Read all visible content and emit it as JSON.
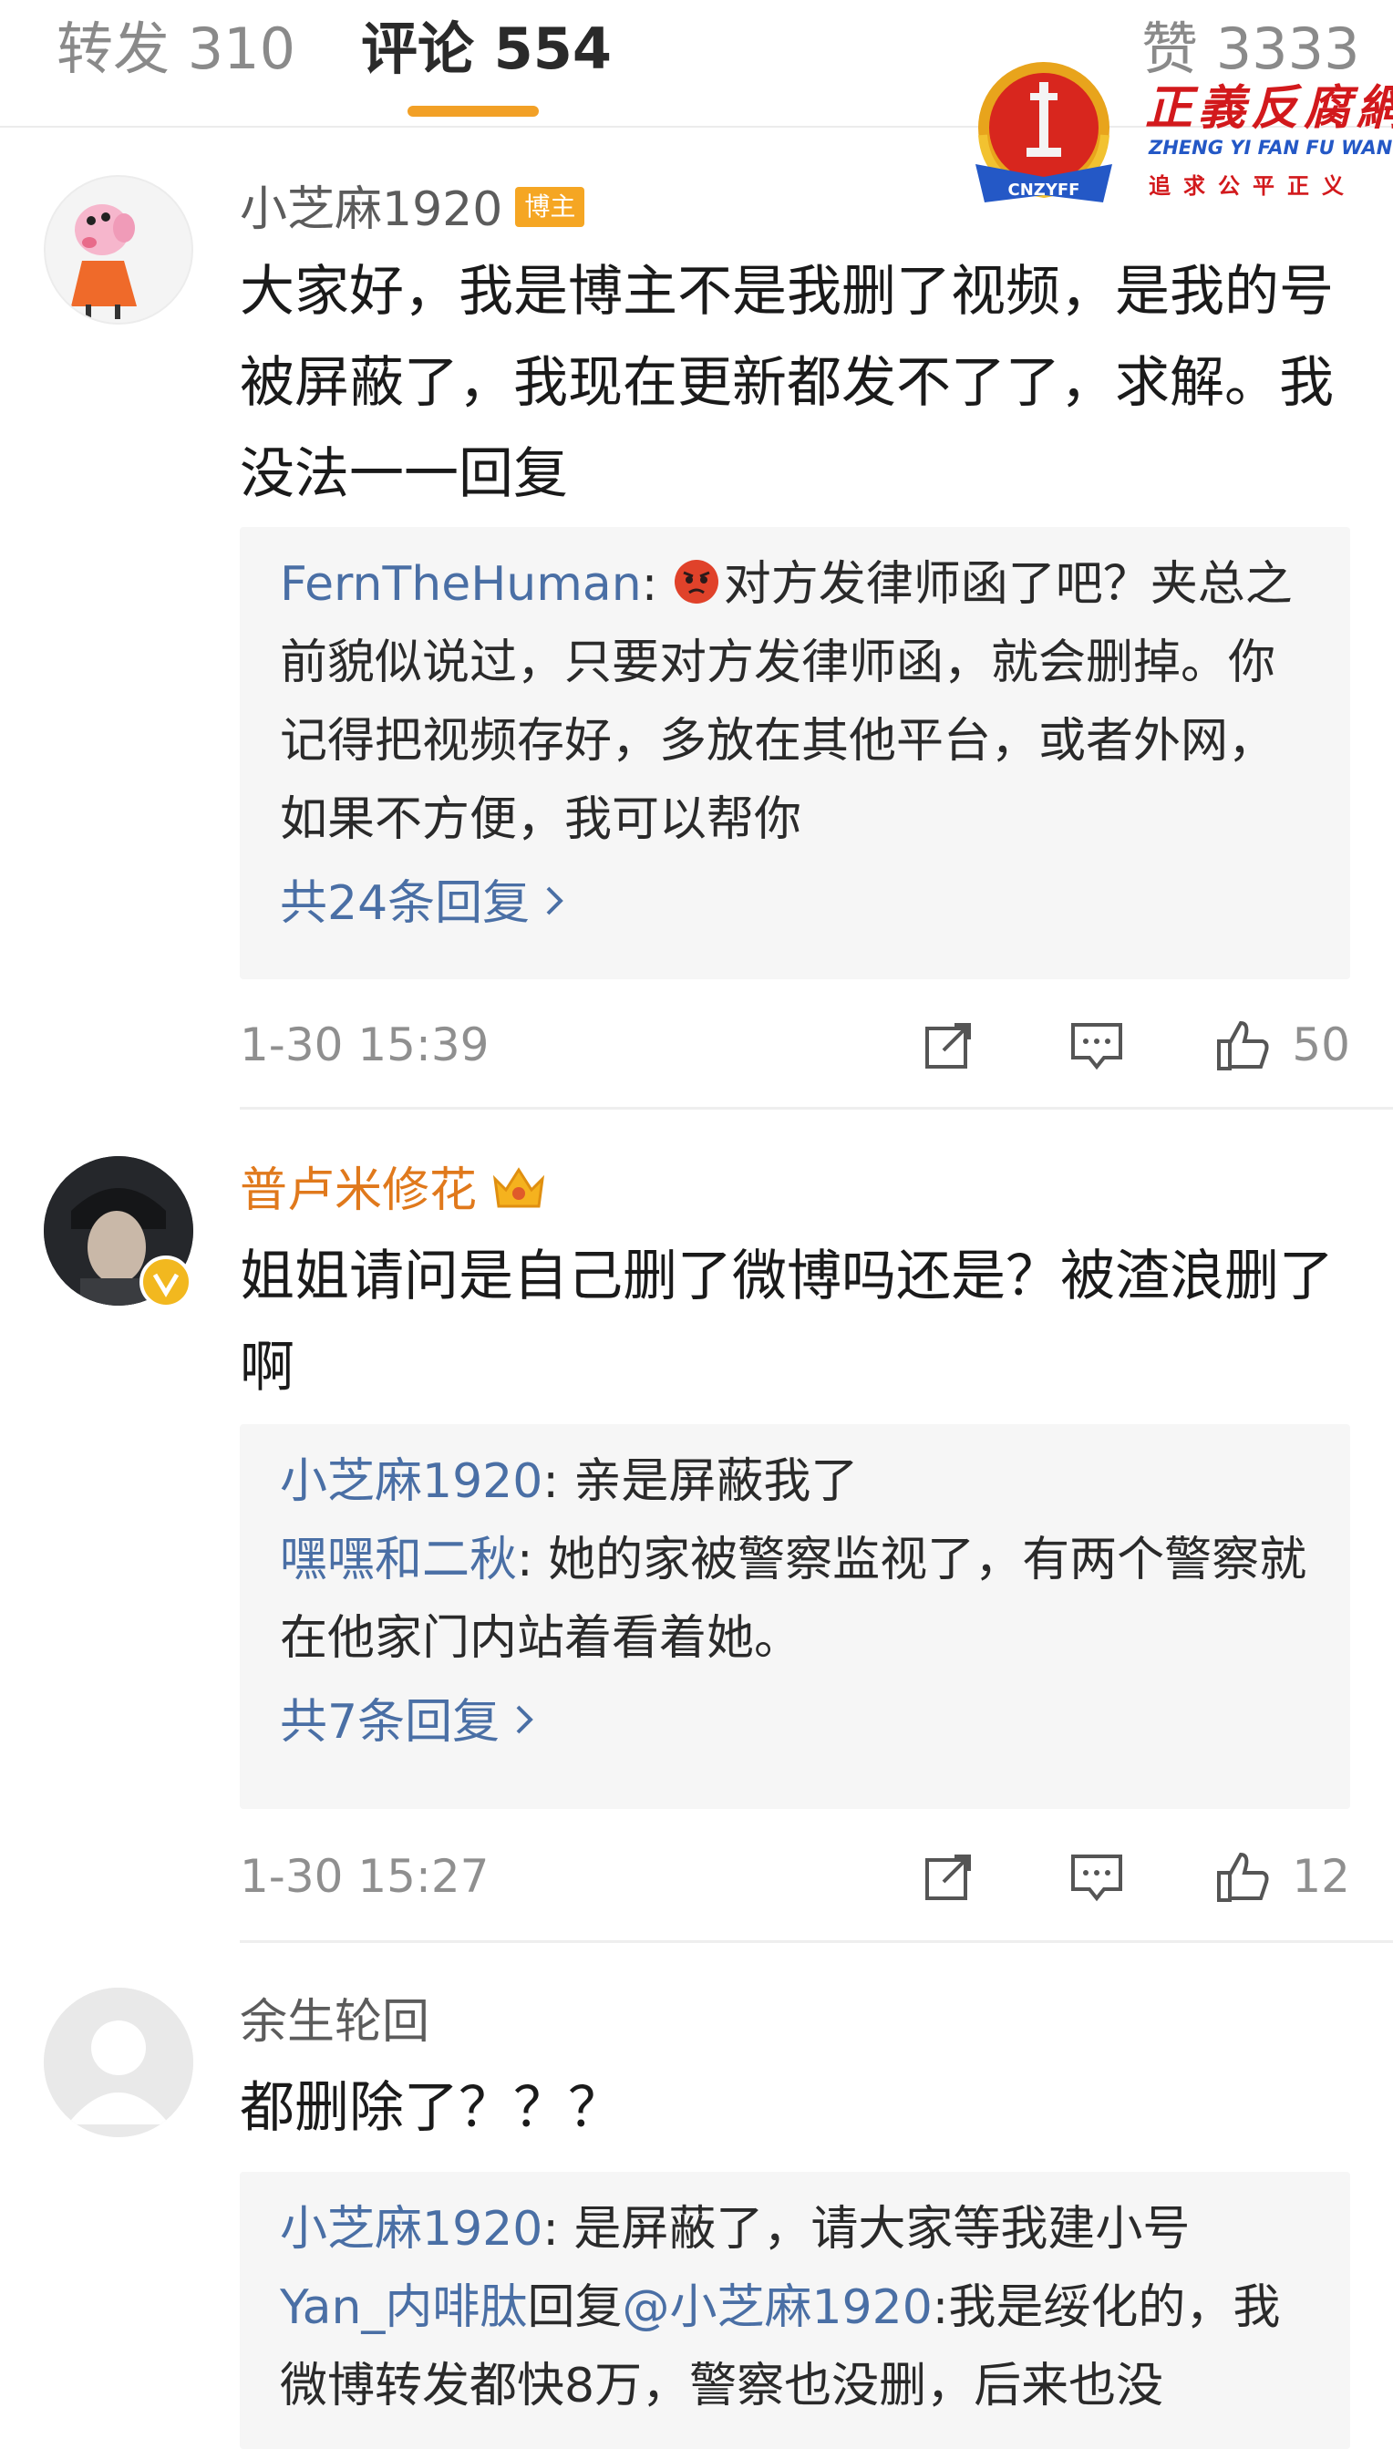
{
  "tabs": [
    {
      "label": "转发",
      "count": "310"
    },
    {
      "label": "评论",
      "count": "554"
    },
    {
      "label": "赞",
      "count": "3333"
    }
  ],
  "watermark": {
    "title": "正義反腐網",
    "subtitle": "ZHENG YI FAN FU WANG",
    "slogan": "追求公平正义",
    "emblem_text": "CNZYFF"
  },
  "comments": [
    {
      "username": "小芝麻1920",
      "badge": "博主",
      "text": "大家好，我是博主不是我删了视频，是我的号被屏蔽了，我现在更新都发不了了，求解。我没法一一回复",
      "replies": [
        {
          "name": "FernTheHuman",
          "sep": ": ",
          "text": "对方发律师函了吧？夹总之前貌似说过，只要对方发律师函，就会删掉。你记得把视频存好，多放在其他平台，或者外网，如果不方便，我可以帮你"
        }
      ],
      "more_replies": "共24条回复",
      "time": "1-30 15:39",
      "likes": "50"
    },
    {
      "username": "普卢米修花",
      "text": "姐姐请问是自己删了微博吗还是？被渣浪删了啊",
      "replies": [
        {
          "name": "小芝麻1920",
          "sep": ": ",
          "text": "亲是屏蔽我了"
        },
        {
          "name": "嘿嘿和二秋",
          "sep": ": ",
          "text": "她的家被警察监视了，有两个警察就在他家门内站着看着她。"
        }
      ],
      "more_replies": "共7条回复",
      "time": "1-30 15:27",
      "likes": "12"
    },
    {
      "username": "余生轮回",
      "text": "都删除了？？？",
      "replies": [
        {
          "name": "小芝麻1920",
          "sep": ": ",
          "text": "是屏蔽了，请大家等我建小号"
        },
        {
          "name": "Yan_内啡肽",
          "reply_word": "回复",
          "mention": "@小芝麻1920",
          "sep": ":",
          "text": "我是绥化的，我微博转发都快8万，警察也没删，后来也没"
        }
      ]
    }
  ],
  "icons": {
    "share": "share-icon",
    "comment": "comment-icon",
    "like": "thumbs-up-icon",
    "chevron": "chevron-right-icon"
  },
  "colors": {
    "accent": "#f2a026",
    "link": "#4a6fa5",
    "vip_name": "#e0791c"
  }
}
